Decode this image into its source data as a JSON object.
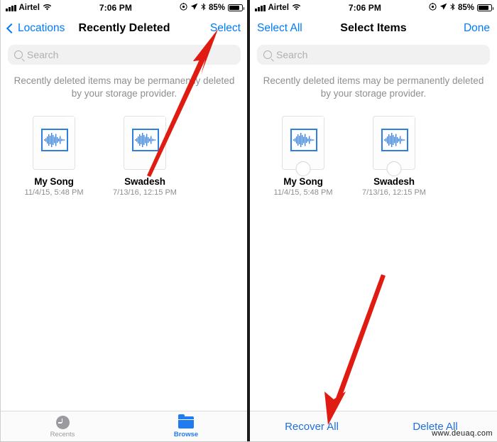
{
  "status_bar": {
    "carrier": "Airtel",
    "time": "7:06 PM",
    "battery_percent": "85%",
    "icons": [
      "signal-bars-icon",
      "wifi-icon",
      "rotation-lock-icon",
      "location-arrow-icon",
      "bluetooth-icon",
      "battery-icon"
    ]
  },
  "panel_left": {
    "nav": {
      "back_label": "Locations",
      "title": "Recently Deleted",
      "action_label": "Select"
    },
    "search": {
      "placeholder": "Search"
    },
    "notice": "Recently deleted items may be permanently deleted by your storage provider.",
    "files": [
      {
        "name": "My Song",
        "date": "11/4/15, 5:48 PM",
        "icon": "audio-document-icon"
      },
      {
        "name": "Swadesh",
        "date": "7/13/16, 12:15 PM",
        "icon": "audio-document-icon"
      }
    ],
    "tabbar": [
      {
        "label": "Recents",
        "icon": "clock-icon",
        "active": false
      },
      {
        "label": "Browse",
        "icon": "folder-icon",
        "active": true
      }
    ]
  },
  "panel_right": {
    "nav": {
      "select_all_label": "Select All",
      "title": "Select Items",
      "done_label": "Done"
    },
    "search": {
      "placeholder": "Search"
    },
    "notice": "Recently deleted items may be permanently deleted by your storage provider.",
    "files": [
      {
        "name": "My Song",
        "date": "11/4/15, 5:48 PM",
        "icon": "audio-document-icon",
        "selected": false
      },
      {
        "name": "Swadesh",
        "date": "7/13/16, 12:15 PM",
        "icon": "audio-document-icon",
        "selected": false
      }
    ],
    "actions": [
      {
        "label": "Recover All"
      },
      {
        "label": "Delete All"
      }
    ]
  },
  "annotations": {
    "arrow_color": "#e01b12",
    "arrow_left": "points from lower-left up to the Select button",
    "arrow_right": "points from upper-right down to the Recover All button"
  },
  "watermark": "www.deuaq.com",
  "colors": {
    "ios_blue": "#007aff",
    "tint_blue": "#1f7bf0",
    "gray_text": "#8e8e93",
    "search_bg": "#efeff0",
    "arrow_red": "#e01b12"
  }
}
